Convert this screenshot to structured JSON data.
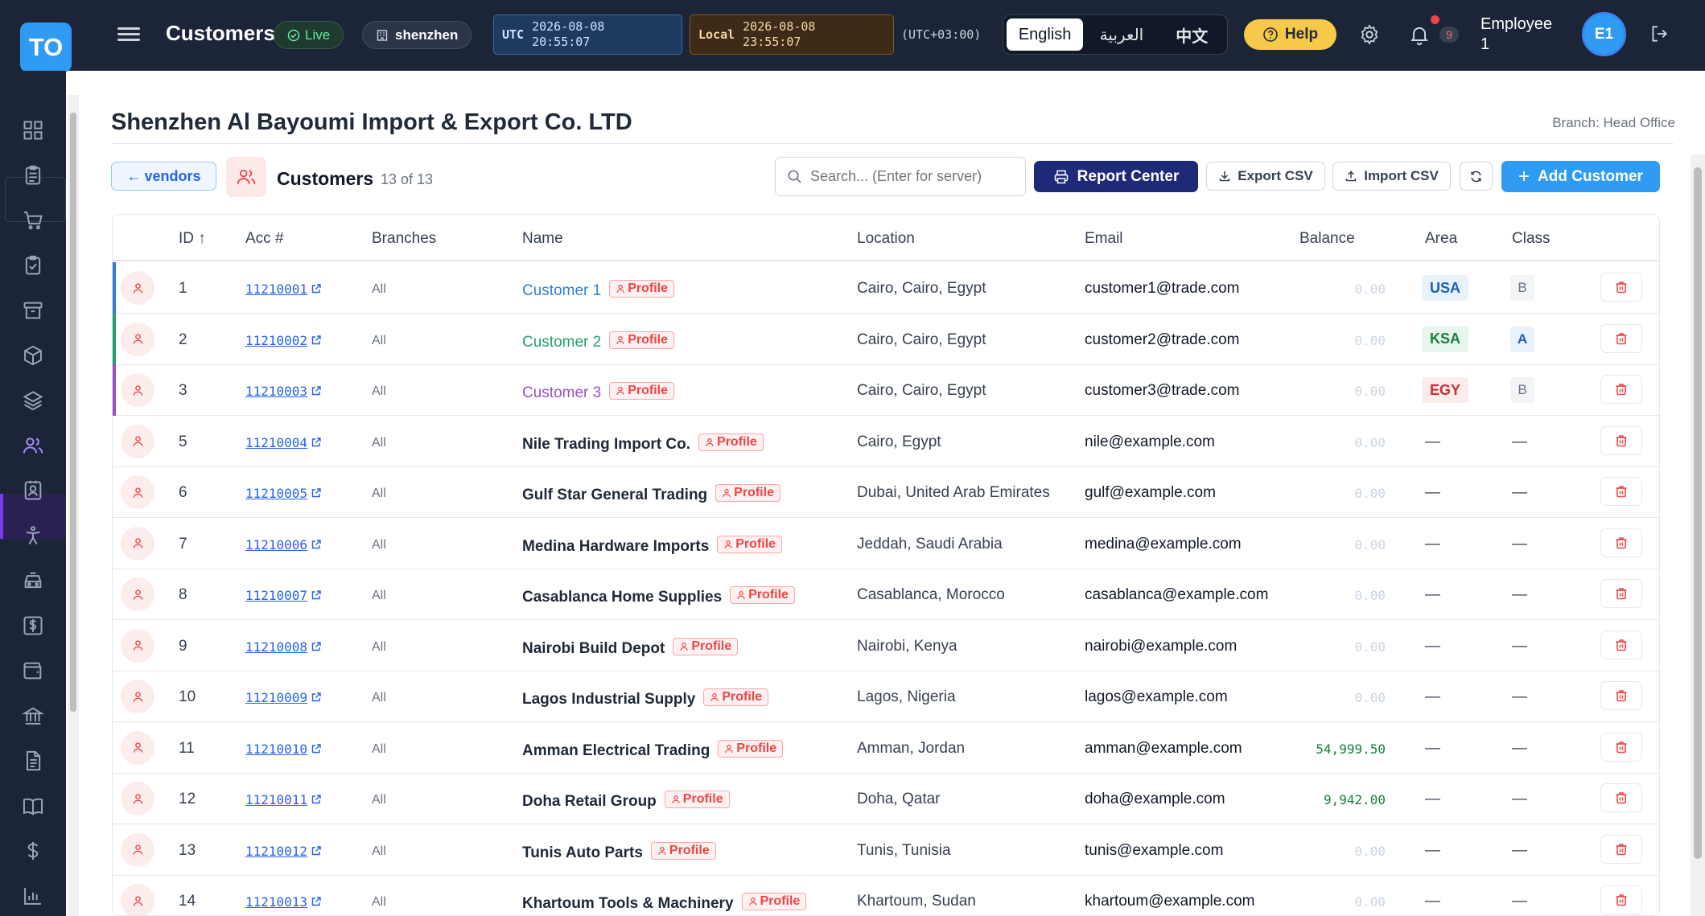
{
  "topbar": {
    "logo": "TO",
    "title": "Customers",
    "live": "Live",
    "branch": "shenzhen",
    "utc_label": "UTC",
    "utc_date": "2026-08-08",
    "utc_time": "20:55:07",
    "local_label": "Local",
    "local_date": "2026-08-08",
    "local_time": "23:55:07",
    "tz": "(UTC+03:00)",
    "languages": [
      "English",
      "العربية",
      "中文"
    ],
    "help": "Help",
    "notif_count": "9",
    "user_line1": "Employee",
    "user_line2": "1",
    "avatar": "E1"
  },
  "page": {
    "company": "Shenzhen Al Bayoumi Import & Export Co. LTD",
    "branch_label": "Branch: Head Office",
    "vendors_btn": "vendors",
    "section_title": "Customers",
    "count": "13 of 13",
    "search_placeholder": "Search... (Enter for server)",
    "report_center": "Report Center",
    "export_csv": "Export CSV",
    "import_csv": "Import CSV",
    "add_customer": "Add Customer"
  },
  "table": {
    "headers": [
      "ID ↑",
      "Acc #",
      "Branches",
      "Name",
      "Location",
      "Email",
      "Balance",
      "Area",
      "Class"
    ],
    "profile_label": "Profile",
    "rows": [
      {
        "id": "1",
        "acc": "11210001",
        "branches": "All",
        "name": "Customer 1",
        "location": "Cairo, Cairo, Egypt",
        "email": "customer1@trade.com",
        "balance": "0.00",
        "area": "USA",
        "class": "B",
        "accent": "#2f7fd8",
        "name_color": "#2f7fd8"
      },
      {
        "id": "2",
        "acc": "11210002",
        "branches": "All",
        "name": "Customer 2",
        "location": "Cairo, Cairo, Egypt",
        "email": "customer2@trade.com",
        "balance": "0.00",
        "area": "KSA",
        "class": "A",
        "accent": "#22a06b",
        "name_color": "#22a06b"
      },
      {
        "id": "3",
        "acc": "11210003",
        "branches": "All",
        "name": "Customer 3",
        "location": "Cairo, Cairo, Egypt",
        "email": "customer3@trade.com",
        "balance": "0.00",
        "area": "EGY",
        "class": "B",
        "accent": "#9b4dca",
        "name_color": "#9b4dca"
      },
      {
        "id": "5",
        "acc": "11210004",
        "branches": "All",
        "name": "Nile Trading Import Co.",
        "location": "Cairo, Egypt",
        "email": "nile@example.com",
        "balance": "0.00",
        "area": "—",
        "class": "—"
      },
      {
        "id": "6",
        "acc": "11210005",
        "branches": "All",
        "name": "Gulf Star General Trading",
        "location": "Dubai, United Arab Emirates",
        "email": "gulf@example.com",
        "balance": "0.00",
        "area": "—",
        "class": "—"
      },
      {
        "id": "7",
        "acc": "11210006",
        "branches": "All",
        "name": "Medina Hardware Imports",
        "location": "Jeddah, Saudi Arabia",
        "email": "medina@example.com",
        "balance": "0.00",
        "area": "—",
        "class": "—"
      },
      {
        "id": "8",
        "acc": "11210007",
        "branches": "All",
        "name": "Casablanca Home Supplies",
        "location": "Casablanca, Morocco",
        "email": "casablanca@example.com",
        "balance": "0.00",
        "area": "—",
        "class": "—"
      },
      {
        "id": "9",
        "acc": "11210008",
        "branches": "All",
        "name": "Nairobi Build Depot",
        "location": "Nairobi, Kenya",
        "email": "nairobi@example.com",
        "balance": "0.00",
        "area": "—",
        "class": "—"
      },
      {
        "id": "10",
        "acc": "11210009",
        "branches": "All",
        "name": "Lagos Industrial Supply",
        "location": "Lagos, Nigeria",
        "email": "lagos@example.com",
        "balance": "0.00",
        "area": "—",
        "class": "—"
      },
      {
        "id": "11",
        "acc": "11210010",
        "branches": "All",
        "name": "Amman Electrical Trading",
        "location": "Amman, Jordan",
        "email": "amman@example.com",
        "balance": "54,999.50",
        "area": "—",
        "class": "—"
      },
      {
        "id": "12",
        "acc": "11210011",
        "branches": "All",
        "name": "Doha Retail Group",
        "location": "Doha, Qatar",
        "email": "doha@example.com",
        "balance": "9,942.00",
        "area": "—",
        "class": "—"
      },
      {
        "id": "13",
        "acc": "11210012",
        "branches": "All",
        "name": "Tunis Auto Parts",
        "location": "Tunis, Tunisia",
        "email": "tunis@example.com",
        "balance": "0.00",
        "area": "—",
        "class": "—"
      },
      {
        "id": "14",
        "acc": "11210013",
        "branches": "All",
        "name": "Khartoum Tools & Machinery",
        "location": "Khartoum, Sudan",
        "email": "khartoum@example.com",
        "balance": "0.00",
        "area": "—",
        "class": "—"
      }
    ]
  },
  "sidebar_icons": [
    "dashboard-icon",
    "clipboard-icon",
    "cart-icon",
    "checklist-icon",
    "archive-icon",
    "box-icon",
    "layers-icon",
    "users-icon",
    "contact-card-icon",
    "person-icon",
    "vehicle-icon",
    "dollar-doc-icon",
    "wallet-icon",
    "bank-icon",
    "document-icon",
    "book-icon",
    "dollar-icon",
    "chart-icon"
  ]
}
